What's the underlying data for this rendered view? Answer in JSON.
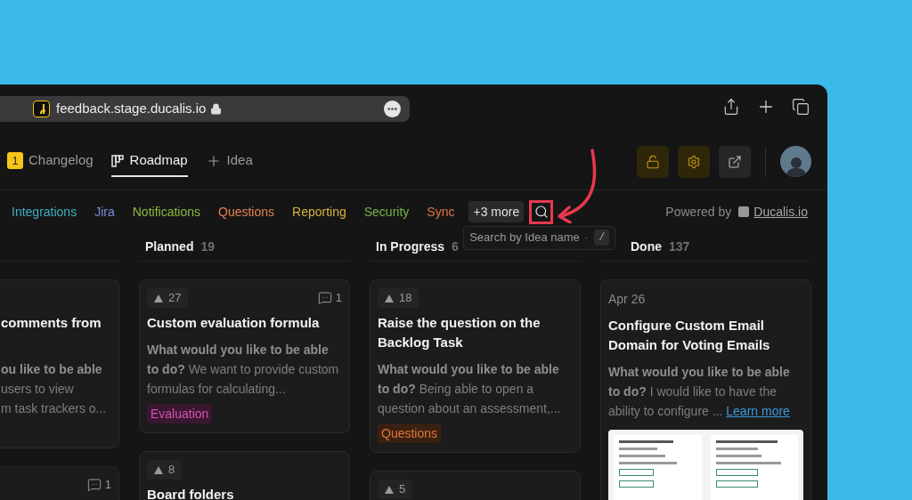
{
  "browser": {
    "url": "feedback.stage.ducalis.io"
  },
  "nav": {
    "tabs": [
      {
        "kind": "changelog",
        "badge": "1",
        "label": "Changelog",
        "selected": false
      },
      {
        "kind": "roadmap",
        "label": "Roadmap",
        "selected": true
      },
      {
        "kind": "idea",
        "label": "Idea",
        "selected": false
      }
    ],
    "actions": [
      {
        "kind": "lock",
        "highlighted": true
      },
      {
        "kind": "settings",
        "highlighted": true
      },
      {
        "kind": "external",
        "highlighted": false
      }
    ]
  },
  "filters": {
    "tags": [
      {
        "label": "Integrations",
        "color": "#3fb0c4"
      },
      {
        "label": "Jira",
        "color": "#7a8ee0"
      },
      {
        "label": "Notifications",
        "color": "#8cba3c"
      },
      {
        "label": "Questions",
        "color": "#e5834c"
      },
      {
        "label": "Reporting",
        "color": "#d6b23c"
      },
      {
        "label": "Security",
        "color": "#76b447"
      },
      {
        "label": "Sync",
        "color": "#e0773e"
      }
    ],
    "more": "+3 more",
    "search_tooltip": "Search by Idea name",
    "search_separator": "·",
    "search_shortcut": "/",
    "powered_by": "Powered by",
    "brand": "Ducalis.io"
  },
  "columns": [
    {
      "cards": [
        {
          "title": "comments from",
          "description_lines": [
            "**ou like to be able**",
            "users to view",
            "m task trackers o..."
          ]
        },
        {
          "comments": "1"
        }
      ]
    },
    {
      "title": "Planned",
      "count": "19",
      "cards": [
        {
          "votes": "27",
          "comments": "1",
          "title": "Custom evaluation formula",
          "description": "**What would you like to be able to do?** We want to provide custom formulas for calculating...",
          "tag": {
            "label": "Evaluation",
            "kind": "pink"
          }
        },
        {
          "votes": "8",
          "title": "Board folders"
        }
      ]
    },
    {
      "title": "In Progress",
      "count": "6",
      "cards": [
        {
          "votes": "18",
          "title": "Raise the question on the Backlog Task",
          "description": "**What would you like to be able to do?** Being able to open a question about an assessment,...",
          "tag": {
            "label": "Questions",
            "kind": "orange"
          }
        },
        {
          "votes": "5"
        }
      ]
    },
    {
      "title": "Done",
      "count": "137",
      "cards": [
        {
          "date": "Apr 26",
          "title": "Configure Custom Email Domain for Voting Emails",
          "description": "**What would you like to be able to do?** I would like to have the ability to configure ...",
          "link": "Learn more",
          "preview": true
        }
      ]
    }
  ]
}
